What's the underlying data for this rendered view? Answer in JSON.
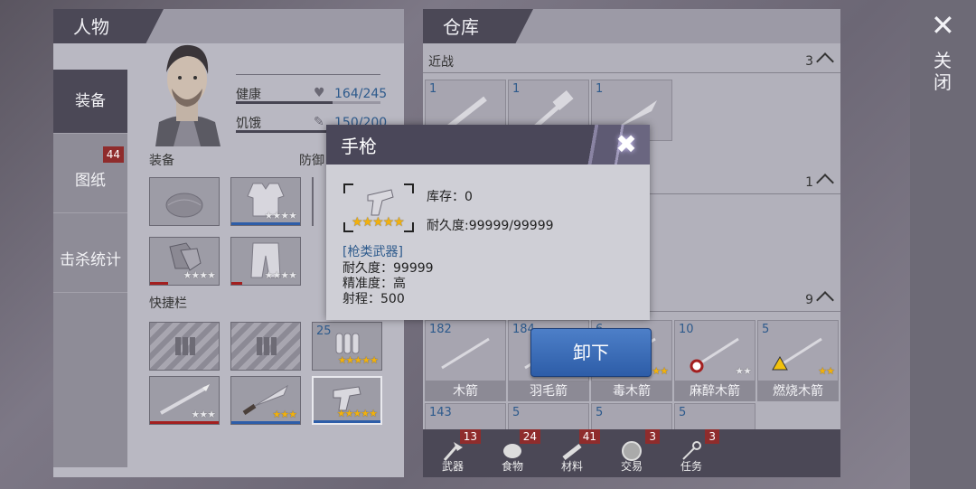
{
  "character_panel": {
    "title": "人物",
    "tabs": [
      {
        "label": "装备",
        "active": true
      },
      {
        "label": "图纸",
        "badge": "44"
      },
      {
        "label": "击杀统计"
      }
    ],
    "stats": {
      "health_label": "健康",
      "health_value": "164/245",
      "health_ratio": 0.67,
      "hunger_label": "饥饿",
      "hunger_value": "150/200",
      "hunger_ratio": 0.75
    },
    "equipment_label": "装备",
    "defense_label": "防御",
    "quickbar_label": "快捷栏",
    "equipment_slots": [
      {
        "icon": "helmet-icon",
        "stars": ""
      },
      {
        "icon": "vest-icon",
        "stars": "★★★★"
      },
      {
        "icon": "gloves-icon",
        "stars": "★★★★"
      },
      {
        "icon": "pants-icon",
        "stars": "★★★★"
      }
    ],
    "quick_slots": [
      {
        "icon": "empty-ammo-icon"
      },
      {
        "icon": "empty-ammo-icon"
      },
      {
        "icon": "bullets-icon",
        "count": "25",
        "stars": "★★★★★"
      },
      {
        "icon": "spear-icon",
        "stars": "★★★"
      },
      {
        "icon": "machete-icon",
        "stars": "★★★"
      },
      {
        "icon": "pistol-icon",
        "stars": "★★★★★"
      }
    ]
  },
  "warehouse": {
    "title": "仓库",
    "melee_label": "近战",
    "melee_count": "3",
    "second_count": "1",
    "third_count": "9",
    "melee_items": [
      {
        "count": "1",
        "icon": "nailed-bat-icon"
      },
      {
        "count": "1",
        "icon": "hammer-icon"
      },
      {
        "count": "1",
        "icon": "machete-icon"
      }
    ],
    "arrows": [
      {
        "count": "182",
        "name": "木箭",
        "stars": ""
      },
      {
        "count": "184",
        "name": "羽毛箭",
        "stars": ""
      },
      {
        "count": "6",
        "name": "毒木箭",
        "stars": "★★"
      },
      {
        "count": "10",
        "name": "麻醉木箭",
        "stars": "★★"
      },
      {
        "count": "5",
        "name": "燃烧木箭",
        "stars": "★★"
      }
    ],
    "row_counts": [
      "143",
      "5",
      "5",
      "5"
    ],
    "bottom_tabs": [
      {
        "label": "武器",
        "badge": "13",
        "icon": "axe-icon"
      },
      {
        "label": "食物",
        "badge": "24",
        "icon": "food-icon"
      },
      {
        "label": "材料",
        "badge": "41",
        "icon": "wood-icon"
      },
      {
        "label": "交易",
        "badge": "3",
        "icon": "coin-icon"
      },
      {
        "label": "任务",
        "badge": "3",
        "icon": "key-icon"
      }
    ]
  },
  "close": {
    "label": "关闭"
  },
  "popup": {
    "title": "手枪",
    "stock": "库存：0",
    "durability_line": "耐久度:99999/99999",
    "stars": "★★★★★",
    "category": "[枪类武器]",
    "detail_durability": "耐久度：99999",
    "detail_accuracy": "精准度：高",
    "detail_range": "射程：500"
  },
  "unequip_button": "卸下",
  "colors": {
    "accent_blue": "#2d5da8",
    "gold_star": "#f2b10c",
    "badge_red": "#8f2c2c",
    "panel_dark": "#4b4856"
  }
}
